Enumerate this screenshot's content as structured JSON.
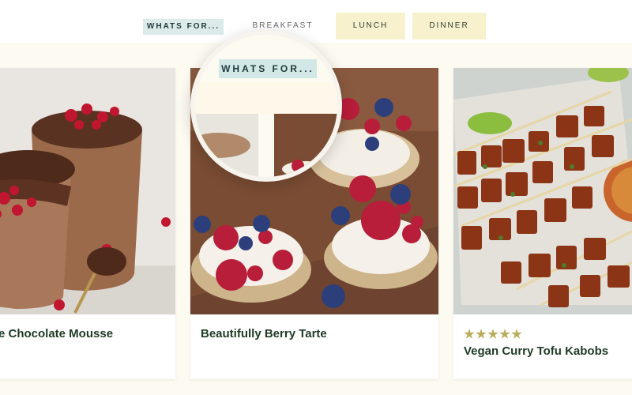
{
  "filter": {
    "label": "WHATS FOR...",
    "tabs": [
      {
        "label": "BREAKFAST",
        "active": true
      },
      {
        "label": "LUNCH",
        "active": false
      },
      {
        "label": "DINNER",
        "active": false
      }
    ]
  },
  "magnifier": {
    "label": "WHATS FOR..."
  },
  "recipes": [
    {
      "title": "e Chocolate Mousse",
      "rating": null
    },
    {
      "title": "Beautifully Berry Tarte",
      "rating": null
    },
    {
      "title": "Vegan Curry Tofu Kabobs",
      "rating": 5
    }
  ],
  "colors": {
    "chip_bg": "#dcebea",
    "tab_bg": "#f8f1cd",
    "title_text": "#1f3a25",
    "star": "#b7ad5a",
    "page_bg": "#fdfaf1"
  }
}
